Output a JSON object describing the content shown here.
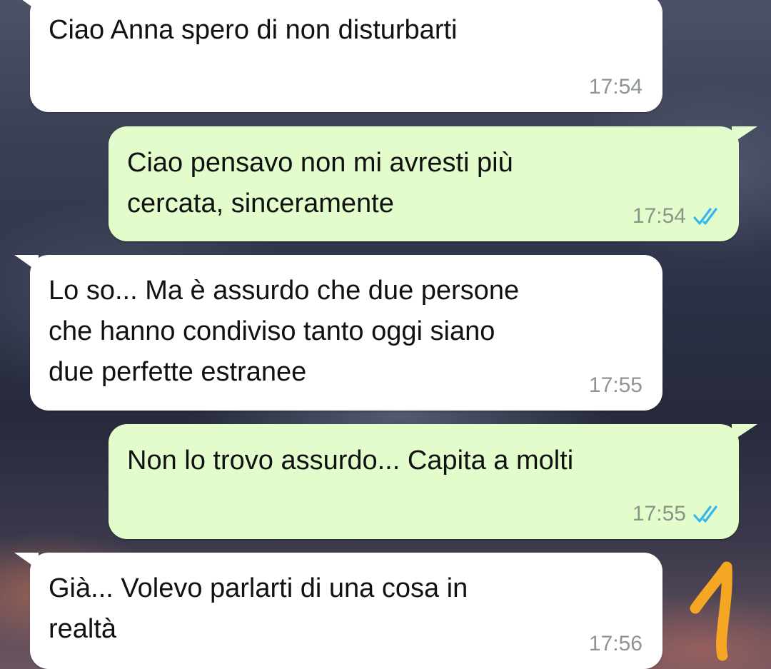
{
  "colors": {
    "incoming_bubble": "#ffffff",
    "outgoing_bubble": "#e2fdcb",
    "read_ticks": "#34b7f1",
    "annotation": "#f5a623"
  },
  "messages": [
    {
      "direction": "incoming",
      "text": "Ciao Anna spero di non disturbarti",
      "time": "17:54"
    },
    {
      "direction": "outgoing",
      "text": "Ciao pensavo non mi avresti più\ncercata, sinceramente",
      "time": "17:54",
      "status": "read-double-tick-icon"
    },
    {
      "direction": "incoming",
      "text": "Lo so... Ma è assurdo che due persone\nche hanno condiviso tanto oggi siano\ndue perfette estranee",
      "time": "17:55"
    },
    {
      "direction": "outgoing",
      "text": "Non lo trovo assurdo... Capita a molti",
      "time": "17:55",
      "status": "read-double-tick-icon"
    },
    {
      "direction": "incoming",
      "text": "Già... Volevo parlarti di una cosa in\nrealtà",
      "time": "17:56"
    }
  ],
  "annotation": {
    "drawn_label": "1"
  }
}
